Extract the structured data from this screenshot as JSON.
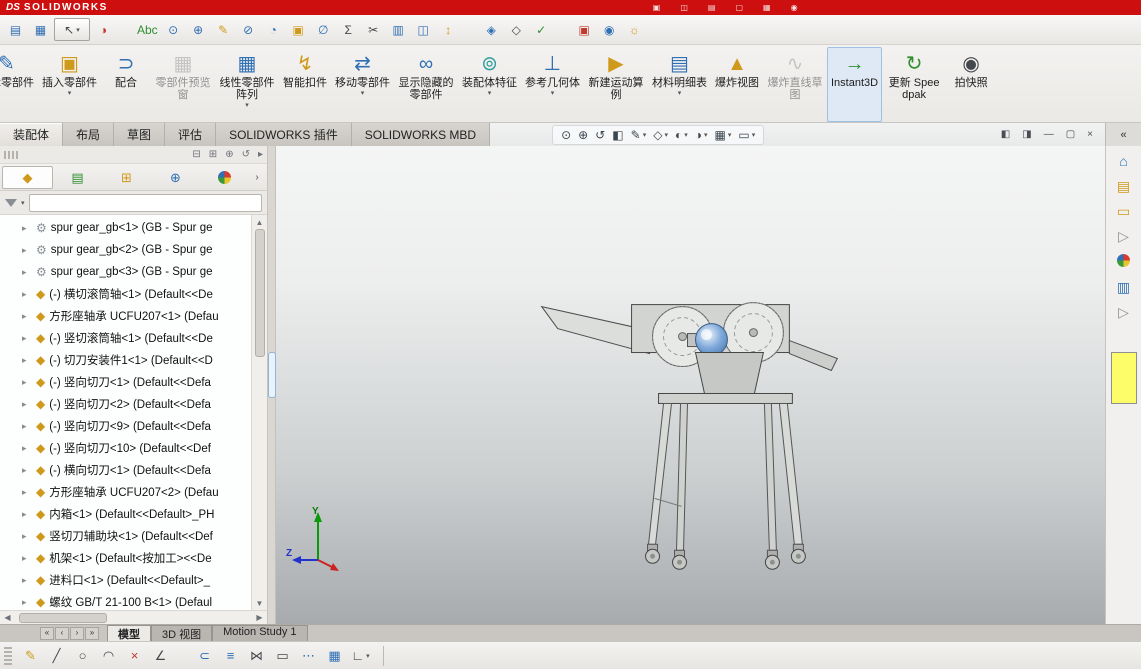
{
  "colors": {
    "titlebar": "#ce0f0f",
    "accent": "#2f6fb3",
    "swatch-yellow": "#fdfd6a"
  },
  "ui": {
    "caret": "▾",
    "expand": "▸",
    "scroll_up": "▲",
    "scroll_down": "▼",
    "scroll_left": "◀",
    "scroll_right": "▶"
  },
  "titlebar": {
    "logo_ds": "DS",
    "logo_text": "SOLIDWORKS",
    "icons": [
      {
        "name": "titlebar-window-icon",
        "glyph": "▣"
      },
      {
        "name": "titlebar-panes-icon",
        "glyph": "◫"
      },
      {
        "name": "titlebar-grid-icon",
        "glyph": "▤"
      },
      {
        "name": "titlebar-doc-icon",
        "glyph": "▢"
      },
      {
        "name": "titlebar-chart-icon",
        "glyph": "▦"
      },
      {
        "name": "titlebar-help-icon",
        "glyph": "◉"
      }
    ]
  },
  "quickbar": {
    "icons": [
      {
        "name": "arrange-windows-button",
        "icon": "arrange-windows-icon",
        "glyph": "▤",
        "tone": "blue"
      },
      {
        "name": "display-pane-button",
        "icon": "display-pane-icon",
        "glyph": "▦",
        "tone": "blue"
      },
      {
        "name": "select-tool-button",
        "icon": "select-cursor-icon",
        "glyph": "↖",
        "tone": "dark",
        "boxed": true,
        "caret": true
      },
      {
        "name": "edit-appearance-button",
        "icon": "appearance-icon",
        "glyph": "◑",
        "tone": "red"
      },
      {
        "name": "spell-check-button",
        "icon": "spellcheck-icon",
        "glyph": "Abc",
        "tone": "green",
        "gap": true
      },
      {
        "name": "design-checker-button",
        "icon": "design-check-icon",
        "glyph": "⊙",
        "tone": "blue"
      },
      {
        "name": "magnified-selection-button",
        "icon": "magnifier-plus-icon",
        "glyph": "⊕",
        "tone": "blue"
      },
      {
        "name": "note-button",
        "icon": "note-pencil-icon",
        "glyph": "✎",
        "tone": "gold"
      },
      {
        "name": "no-preview-button",
        "icon": "no-preview-icon",
        "glyph": "⊘",
        "tone": "blue"
      },
      {
        "name": "rotate-view-button",
        "icon": "rotate-icon",
        "glyph": "◔",
        "tone": "blue"
      },
      {
        "name": "pattern-button",
        "icon": "pattern-icon",
        "glyph": "▣",
        "tone": "gold"
      },
      {
        "name": "measure-button",
        "icon": "measure-icon",
        "glyph": "∅",
        "tone": "blue"
      },
      {
        "name": "equations-button",
        "icon": "sigma-icon",
        "glyph": "Σ",
        "tone": "dark"
      },
      {
        "name": "trim-button",
        "icon": "scissors-icon",
        "glyph": "✂",
        "tone": "dark"
      },
      {
        "name": "mass-properties-button",
        "icon": "mass-properties-icon",
        "glyph": "▥",
        "tone": "blue"
      },
      {
        "name": "section-properties-button",
        "icon": "section-properties-icon",
        "glyph": "◫",
        "tone": "blue"
      },
      {
        "name": "sensors-button",
        "icon": "sensors-icon",
        "glyph": "↕",
        "tone": "gold"
      },
      {
        "name": "reference-triad-button",
        "icon": "triad-icon",
        "glyph": "◈",
        "tone": "blue",
        "gap": true
      },
      {
        "name": "coordinate-system-button",
        "icon": "coordinate-icon",
        "glyph": "◇",
        "tone": "dark"
      },
      {
        "name": "selection-filter-button",
        "icon": "filter-check-icon",
        "glyph": "✓",
        "tone": "green"
      },
      {
        "name": "addins-button",
        "icon": "addins-icon",
        "glyph": "▣",
        "tone": "red",
        "gap": true
      },
      {
        "name": "web-help-button",
        "icon": "globe-icon",
        "glyph": "◉",
        "tone": "blue"
      },
      {
        "name": "options-button",
        "icon": "options-sun-icon",
        "glyph": "☼",
        "tone": "gold"
      }
    ]
  },
  "ribbon": {
    "buttons": [
      {
        "name": "edit-component-button",
        "icon": "edit-component-icon",
        "label": "编辑零部件",
        "glyph": "✎",
        "tone": "blue",
        "clipped": true
      },
      {
        "name": "insert-component-button",
        "icon": "insert-component-icon",
        "label": "插入零部件",
        "glyph": "▣",
        "tone": "gold",
        "caret": true
      },
      {
        "name": "mate-button",
        "icon": "mate-icon",
        "label": "配合",
        "glyph": "⊃",
        "tone": "blue"
      },
      {
        "name": "component-preview-button",
        "icon": "component-preview-icon",
        "label": "零部件预览窗",
        "glyph": "▦",
        "tone": "gray",
        "disabled": true
      },
      {
        "name": "linear-component-pattern-button",
        "icon": "linear-pattern-icon",
        "label": "线性零部件阵列",
        "glyph": "▦",
        "tone": "blue",
        "caret": true
      },
      {
        "name": "smart-fasteners-button",
        "icon": "smart-fasteners-icon",
        "label": "智能扣件",
        "glyph": "↯",
        "tone": "gold"
      },
      {
        "name": "move-component-button",
        "icon": "move-component-icon",
        "label": "移动零部件",
        "glyph": "⇄",
        "tone": "blue",
        "caret": true
      },
      {
        "name": "show-hidden-components-button",
        "icon": "show-hidden-icon",
        "label": "显示隐藏的零部件",
        "glyph": "∞",
        "tone": "blue"
      },
      {
        "name": "assembly-features-button",
        "icon": "assembly-features-icon",
        "label": "装配体特征",
        "glyph": "⊚",
        "tone": "teal",
        "caret": true
      },
      {
        "name": "reference-geometry-button",
        "icon": "reference-geometry-icon",
        "label": "参考几何体",
        "glyph": "⊥",
        "tone": "blue",
        "caret": true
      },
      {
        "name": "new-motion-study-button",
        "icon": "new-motion-study-icon",
        "label": "新建运动算例",
        "glyph": "▶",
        "tone": "gold"
      },
      {
        "name": "bill-of-materials-button",
        "icon": "bom-icon",
        "label": "材料明细表",
        "glyph": "▤",
        "tone": "blue",
        "caret": true
      },
      {
        "name": "exploded-view-button",
        "icon": "exploded-view-icon",
        "label": "爆炸视图",
        "glyph": "▲",
        "tone": "gold"
      },
      {
        "name": "explode-line-sketch-button",
        "icon": "explode-line-sketch-icon",
        "label": "爆炸直线草图",
        "glyph": "∿",
        "tone": "gray",
        "disabled": true
      },
      {
        "name": "instant3d-button",
        "icon": "instant3d-icon",
        "label": "Instant3D",
        "glyph": "→",
        "tone": "green",
        "pressed": true
      },
      {
        "name": "update-speedpak-button",
        "icon": "update-speedpak-icon",
        "label": "更新 Speedpak",
        "glyph": "↻",
        "tone": "green"
      },
      {
        "name": "take-snapshot-button",
        "icon": "snapshot-icon",
        "label": "拍快照",
        "glyph": "◉",
        "tone": "dark"
      }
    ]
  },
  "command_tabs": {
    "items": [
      {
        "name": "tab-assembly",
        "label": "装配体",
        "active": true
      },
      {
        "name": "tab-layout",
        "label": "布局"
      },
      {
        "name": "tab-sketch",
        "label": "草图"
      },
      {
        "name": "tab-evaluate",
        "label": "评估"
      },
      {
        "name": "tab-addins",
        "label": "SOLIDWORKS 插件"
      },
      {
        "name": "tab-mbd",
        "label": "SOLIDWORKS MBD"
      }
    ]
  },
  "headsup": {
    "icons": [
      {
        "name": "zoom-fit-icon",
        "glyph": "⊙"
      },
      {
        "name": "zoom-area-icon",
        "glyph": "⊕"
      },
      {
        "name": "previous-view-icon",
        "glyph": "↺"
      },
      {
        "name": "section-view-icon",
        "glyph": "◧"
      },
      {
        "name": "annotations-visibility-icon",
        "glyph": "✎",
        "caret": true
      },
      {
        "name": "display-style-icon",
        "glyph": "◇",
        "caret": true
      },
      {
        "name": "hide-show-items-icon",
        "glyph": "◐",
        "caret": true
      },
      {
        "name": "edit-appearance-icon",
        "glyph": "◑",
        "caret": true
      },
      {
        "name": "apply-scene-icon",
        "glyph": "▦",
        "caret": true
      },
      {
        "name": "view-settings-icon",
        "glyph": "▭",
        "caret": true
      }
    ]
  },
  "window_controls": [
    {
      "name": "previous-pane-button",
      "glyph": "◧"
    },
    {
      "name": "next-pane-button",
      "glyph": "◨"
    },
    {
      "name": "minimize-button",
      "glyph": "—"
    },
    {
      "name": "restore-button",
      "glyph": "▢"
    },
    {
      "name": "close-button",
      "glyph": "×"
    }
  ],
  "feature_panel": {
    "strip_icons": [
      {
        "name": "flat-tree-view-icon",
        "glyph": "⊟"
      },
      {
        "name": "expand-all-icon",
        "glyph": "⊞"
      },
      {
        "name": "zoom-to-selection-icon",
        "glyph": "⊕"
      },
      {
        "name": "rollback-icon",
        "glyph": "↺"
      },
      {
        "name": "panel-more-icon",
        "glyph": "▸"
      }
    ],
    "manager_tabs": [
      {
        "name": "featuremanager-tab",
        "icon": "assembly-tree-icon",
        "glyph": "◆",
        "tone": "gold",
        "active": true
      },
      {
        "name": "propertymanager-tab",
        "icon": "property-manager-icon",
        "glyph": "▤",
        "tone": "green"
      },
      {
        "name": "configurationmanager-tab",
        "icon": "configuration-manager-icon",
        "glyph": "⊞",
        "tone": "gold"
      },
      {
        "name": "dimxpertmanager-tab",
        "icon": "dimxpert-manager-icon",
        "glyph": "⊕",
        "tone": "blue"
      },
      {
        "name": "displaymanager-tab",
        "icon": "beachball-icon",
        "glyph": "",
        "ball": true
      }
    ],
    "tabs_overflow": "›",
    "tree_items": [
      {
        "label": "spur gear_gb<1> (GB - Spur ge",
        "icon": "toolbox-gear-part-icon",
        "glyph": "⚙",
        "tone": "gray"
      },
      {
        "label": "spur gear_gb<2> (GB - Spur ge",
        "icon": "toolbox-gear-part-icon",
        "glyph": "⚙",
        "tone": "gray"
      },
      {
        "label": "spur gear_gb<3> (GB - Spur ge",
        "icon": "toolbox-gear-part-icon",
        "glyph": "⚙",
        "tone": "gray"
      },
      {
        "label": "(-) 横切滚筒轴<1> (Default<<De",
        "icon": "part-icon",
        "glyph": "◆",
        "tone": "gold"
      },
      {
        "label": "方形座轴承 UCFU207<1> (Defau",
        "icon": "part-icon",
        "glyph": "◆",
        "tone": "gold"
      },
      {
        "label": "(-) 竖切滚筒轴<1> (Default<<De",
        "icon": "part-icon",
        "glyph": "◆",
        "tone": "gold"
      },
      {
        "label": "(-) 切刀安装件1<1> (Default<<D",
        "icon": "part-icon",
        "glyph": "◆",
        "tone": "gold"
      },
      {
        "label": "(-) 竖向切刀<1> (Default<<Defa",
        "icon": "part-icon",
        "glyph": "◆",
        "tone": "gold"
      },
      {
        "label": "(-) 竖向切刀<2> (Default<<Defa",
        "icon": "part-icon",
        "glyph": "◆",
        "tone": "gold"
      },
      {
        "label": "(-) 竖向切刀<9> (Default<<Defa",
        "icon": "part-icon",
        "glyph": "◆",
        "tone": "gold"
      },
      {
        "label": "(-) 竖向切刀<10> (Default<<Def",
        "icon": "part-icon",
        "glyph": "◆",
        "tone": "gold"
      },
      {
        "label": "(-) 横向切刀<1> (Default<<Defa",
        "icon": "part-icon",
        "glyph": "◆",
        "tone": "gold"
      },
      {
        "label": "方形座轴承 UCFU207<2> (Defau",
        "icon": "part-icon",
        "glyph": "◆",
        "tone": "gold"
      },
      {
        "label": "内箱<1> (Default<<Default>_PH",
        "icon": "part-icon",
        "glyph": "◆",
        "tone": "gold"
      },
      {
        "label": "竖切刀辅助块<1> (Default<<Def",
        "icon": "part-icon",
        "glyph": "◆",
        "tone": "gold"
      },
      {
        "label": "机架<1> (Default<按加工><<De",
        "icon": "part-icon",
        "glyph": "◆",
        "tone": "gold"
      },
      {
        "label": "进料口<1> (Default<<Default>_",
        "icon": "part-icon",
        "glyph": "◆",
        "tone": "gold"
      },
      {
        "label": "螺纹 GB/T 21-100 B<1> (Defaul",
        "icon": "part-icon",
        "glyph": "◆",
        "tone": "gold"
      }
    ]
  },
  "taskpane": {
    "collapse": "«",
    "icons": [
      {
        "name": "taskpane-home-button",
        "icon": "home-icon",
        "glyph": "⌂",
        "tone": "blue"
      },
      {
        "name": "design-library-button",
        "icon": "design-library-icon",
        "glyph": "▤",
        "tone": "gold"
      },
      {
        "name": "file-explorer-button",
        "icon": "folder-icon",
        "glyph": "▭",
        "tone": "gold"
      },
      {
        "name": "expand-pane-button",
        "icon": "expand-arrow-icon",
        "glyph": "▷",
        "tone": "gray"
      },
      {
        "name": "appearances-button",
        "icon": "beachball-icon",
        "glyph": "",
        "ball": true
      },
      {
        "name": "custom-properties-button",
        "icon": "properties-list-icon",
        "glyph": "▥",
        "tone": "blue"
      },
      {
        "name": "expand-pane2-button",
        "icon": "expand-arrow-icon",
        "glyph": "▷",
        "tone": "gray"
      }
    ]
  },
  "viewport": {
    "triad_up": "Y",
    "triad_left": "Z"
  },
  "model_bar": {
    "nav": [
      {
        "name": "scroll-first-button",
        "glyph": "«"
      },
      {
        "name": "scroll-prev-button",
        "glyph": "‹"
      },
      {
        "name": "scroll-next-button",
        "glyph": "›"
      },
      {
        "name": "scroll-last-button",
        "glyph": "»"
      }
    ],
    "tabs": [
      {
        "name": "model-tab",
        "label": "模型",
        "active": true
      },
      {
        "name": "3d-views-tab",
        "label": "3D 视图"
      },
      {
        "name": "motion-study-tab",
        "label": "Motion Study 1"
      }
    ]
  },
  "bottom_toolbar": {
    "icons": [
      {
        "name": "sketch-button",
        "icon": "sketch-pencil-icon",
        "glyph": "✎",
        "tone": "gold"
      },
      {
        "name": "line-button",
        "icon": "line-icon",
        "glyph": "╱",
        "tone": "dark"
      },
      {
        "name": "circle-button",
        "icon": "circle-icon",
        "glyph": "○",
        "tone": "dark"
      },
      {
        "name": "arc-button",
        "icon": "arc-icon",
        "glyph": "◠",
        "tone": "dark"
      },
      {
        "name": "trim-entities-button",
        "icon": "trim-icon",
        "glyph": "×",
        "tone": "red"
      },
      {
        "name": "smart-dimension-button",
        "icon": "dimension-icon",
        "glyph": "∠",
        "tone": "dark"
      },
      {
        "name": "convert-entities-button",
        "icon": "convert-entities-icon",
        "glyph": "⊂",
        "tone": "blue",
        "gap": true
      },
      {
        "name": "offset-entities-button",
        "icon": "offset-icon",
        "glyph": "≡",
        "tone": "blue"
      },
      {
        "name": "mirror-entities-button",
        "icon": "mirror-icon",
        "glyph": "⋈",
        "tone": "dark"
      },
      {
        "name": "rectangle-button",
        "icon": "rectangle-icon",
        "glyph": "▭",
        "tone": "dark"
      },
      {
        "name": "sketch-pattern-button",
        "icon": "sketch-pattern-icon",
        "glyph": "⋯",
        "tone": "blue"
      },
      {
        "name": "grid-button",
        "icon": "grid-icon",
        "glyph": "▦",
        "tone": "blue"
      },
      {
        "name": "fillet-button",
        "icon": "fillet-icon",
        "glyph": "∟",
        "tone": "dark",
        "caret": true
      }
    ]
  }
}
